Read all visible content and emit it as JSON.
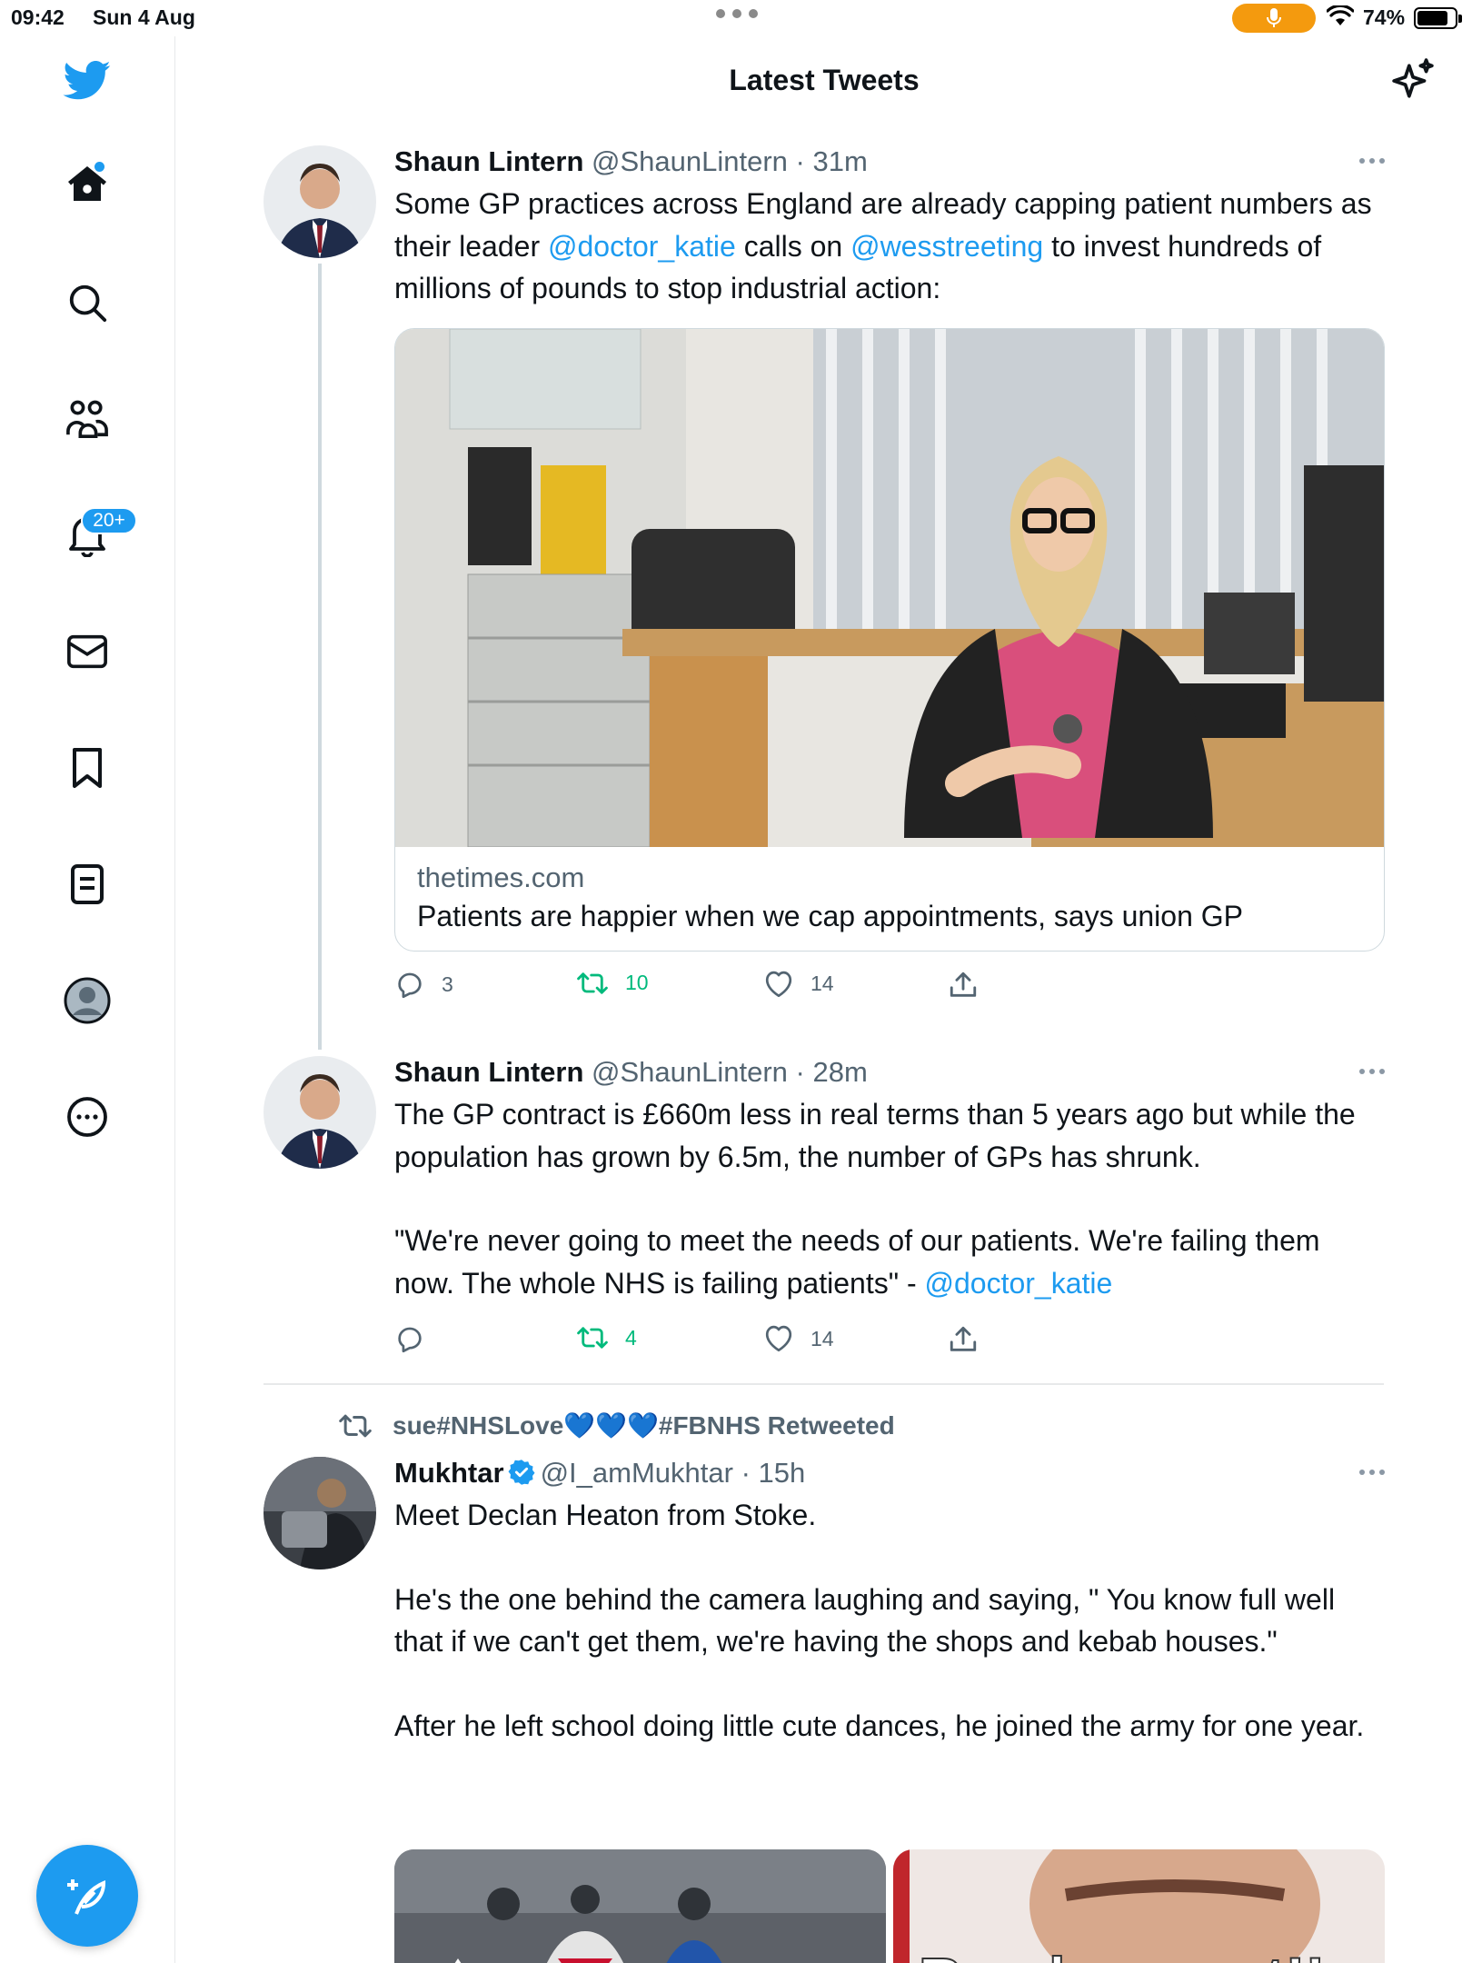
{
  "status_bar": {
    "time": "09:42",
    "date": "Sun 4 Aug",
    "battery": "74%"
  },
  "header": {
    "title": "Latest Tweets"
  },
  "sidebar": {
    "notifications_badge": "20+"
  },
  "tweets": [
    {
      "name": "Shaun Lintern",
      "handle": "@ShaunLintern",
      "time": "31m",
      "text_parts": [
        "Some GP practices across England are already capping patient numbers as their leader ",
        "@doctor_katie",
        " calls on ",
        "@wesstreeting",
        " to invest hundreds of millions of pounds to stop industrial action:"
      ],
      "card": {
        "domain": "thetimes.com",
        "headline": "Patients are happier when we cap appointments, says union GP"
      },
      "replies": "3",
      "retweets": "10",
      "likes": "14"
    },
    {
      "name": "Shaun Lintern",
      "handle": "@ShaunLintern",
      "time": "28m",
      "text_p1": "The GP contract is £660m less in real terms than 5 years ago but while the population has grown by 6.5m, the number of GPs has shrunk.",
      "text_p2": "\"We're never going to meet the needs of our patients. We're failing them now. The whole NHS is failing patients\" - ",
      "text_p2_mention": "@doctor_katie",
      "replies": "",
      "retweets": "4",
      "likes": "14"
    },
    {
      "retweeted_by": "sue#NHSLove💙💙💙#FBNHS Retweeted",
      "name": "Mukhtar",
      "handle": "@I_amMukhtar",
      "time": "15h",
      "text_p1": "Meet Declan Heaton from Stoke.",
      "text_p2": "He's the one behind the camera laughing and saying, \" You know full well that if we can't get them, we're having the shops and kebab houses.\"",
      "text_p3": "After he left school doing little cute dances, he joined the army for one year.",
      "media_caption": "Ready or not!!"
    }
  ],
  "colors": {
    "accent": "#1d9bf0",
    "retweet": "#00ba7c",
    "secondary_text": "#536471"
  }
}
